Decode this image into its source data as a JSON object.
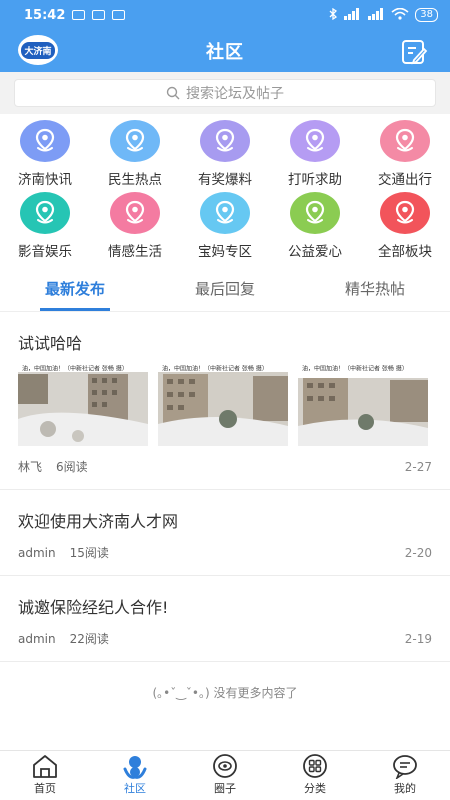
{
  "status_bar": {
    "time": "15:42",
    "battery": "38"
  },
  "header": {
    "title": "社区",
    "logo_text": "大济南"
  },
  "search": {
    "placeholder": "搜索论坛及帖子"
  },
  "categories": [
    {
      "label": "济南快讯",
      "color": "#7d9cf5"
    },
    {
      "label": "民生热点",
      "color": "#6fb8f7"
    },
    {
      "label": "有奖爆料",
      "color": "#a79bf0"
    },
    {
      "label": "打听求助",
      "color": "#b59cf3"
    },
    {
      "label": "交通出行",
      "color": "#f48aa5"
    },
    {
      "label": "影音娱乐",
      "color": "#26c5b4"
    },
    {
      "label": "情感生活",
      "color": "#f47ba1"
    },
    {
      "label": "宝妈专区",
      "color": "#66c8f2"
    },
    {
      "label": "公益爱心",
      "color": "#8bcc52"
    },
    {
      "label": "全部板块",
      "color": "#f2545b"
    }
  ],
  "tabs": [
    {
      "label": "最新发布",
      "active": true
    },
    {
      "label": "最后回复",
      "active": false
    },
    {
      "label": "精华热帖",
      "active": false
    }
  ],
  "posts": [
    {
      "title": "试试哈哈",
      "author": "林飞",
      "reads": "6阅读",
      "date": "2-27",
      "images": 3
    },
    {
      "title": "欢迎使用大济南人才网",
      "author": "admin",
      "reads": "15阅读",
      "date": "2-20"
    },
    {
      "title": "诚邀保险经纪人合作!",
      "author": "admin",
      "reads": "22阅读",
      "date": "2-19"
    }
  ],
  "thumb_captions": [
    "油，中国加油！（中新社记者 张畅 摄）",
    "油，中国加油！（中新社记者 张畅 摄）",
    "油，中国加油！（中新社记者 张畅 摄）"
  ],
  "no_more": "(｡•ˇ‿ˇ•｡) 没有更多内容了",
  "bottom_nav": [
    {
      "label": "首页",
      "icon": "home-icon"
    },
    {
      "label": "社区",
      "icon": "community-icon",
      "active": true
    },
    {
      "label": "圈子",
      "icon": "circle-icon"
    },
    {
      "label": "分类",
      "icon": "category-icon"
    },
    {
      "label": "我的",
      "icon": "profile-icon"
    }
  ],
  "colors": {
    "primary": "#4a9ff0",
    "accent": "#2f7fdb"
  }
}
